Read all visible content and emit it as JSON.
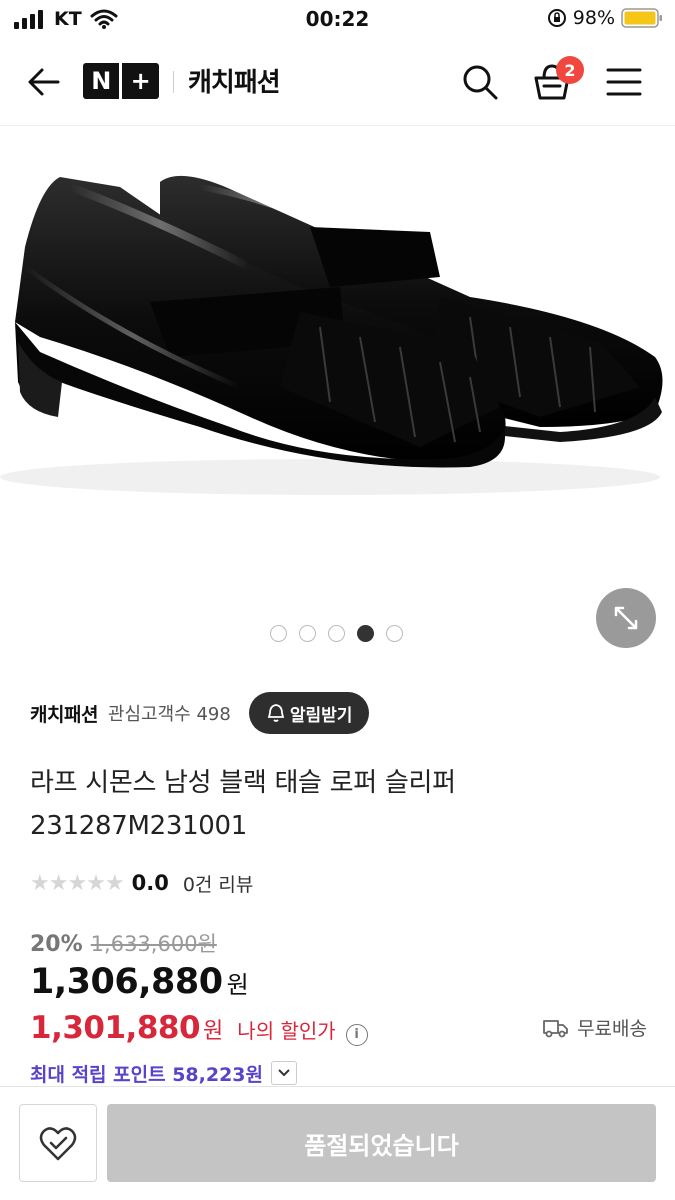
{
  "status_bar": {
    "carrier": "KT",
    "time": "00:22",
    "battery": "98%"
  },
  "nav": {
    "logo_left": "N",
    "logo_right": "+",
    "title": "캐치패션",
    "cart_count": "2",
    "icons": [
      "back-arrow-icon",
      "search-icon",
      "basket-icon",
      "hamburger-menu-icon"
    ]
  },
  "gallery": {
    "total": 5,
    "active_index": 4
  },
  "seller": {
    "name": "캐치패션",
    "followers": "관심고객수 498",
    "alarm_label": "알림받기"
  },
  "product": {
    "title_line1": "라프 시몬스 남성 블랙 태슬 로퍼 슬리퍼",
    "title_line2": "231287M231001",
    "rating": "0.0",
    "reviews": "0건 리뷰",
    "discount_rate": "20%",
    "original_price": "1,633,600원",
    "price": "1,306,880",
    "price_unit": "원",
    "my_price": "1,301,880",
    "my_price_unit": "원",
    "my_price_label": "나의 할인가",
    "shipping": "무료배송",
    "points": "최대 적립 포인트 58,223원"
  },
  "bottom_bar": {
    "soldout_label": "품절되었습니다"
  },
  "colors": {
    "accent_red": "#d8263a",
    "points_purple": "#5a43c9",
    "badge": "#f0483e",
    "soldout_gray": "#c4c4c4"
  }
}
